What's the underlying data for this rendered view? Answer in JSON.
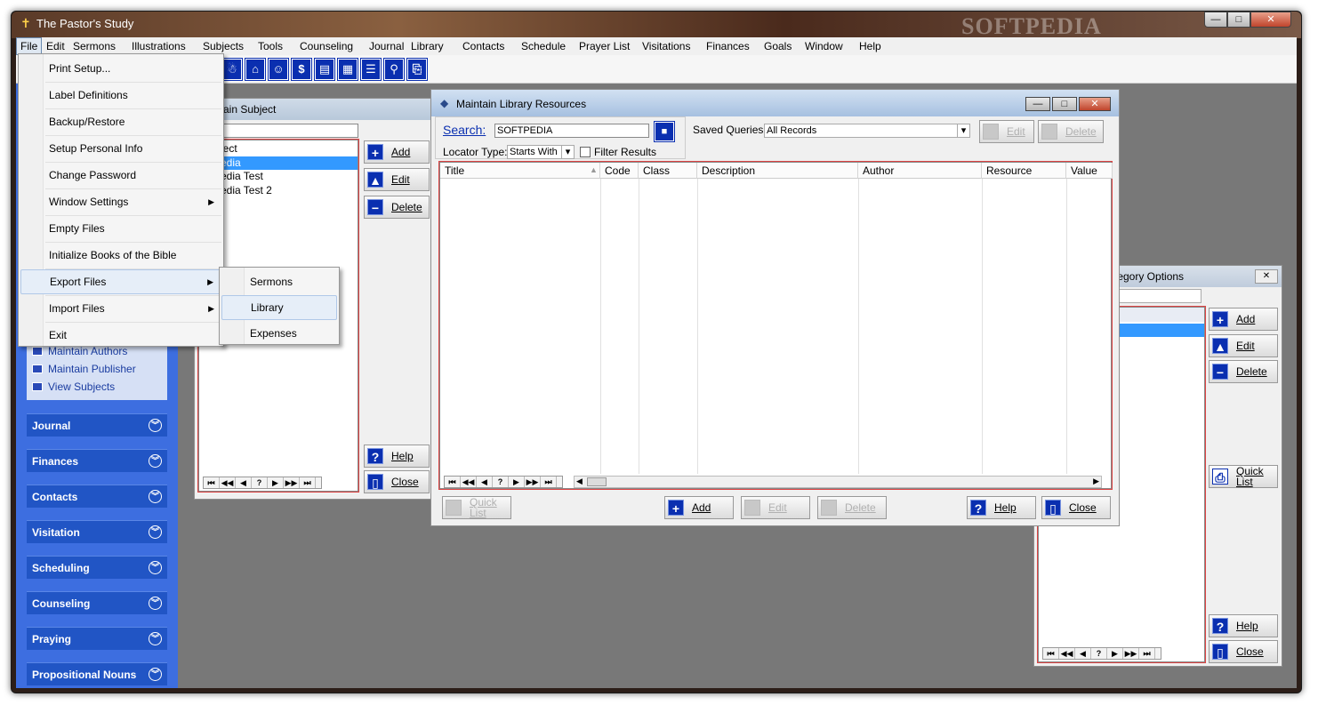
{
  "app": {
    "title": "The Pastor's Study",
    "watermark": "SOFTPEDIA",
    "caption_min": "—",
    "caption_max": "□",
    "caption_close": "✕"
  },
  "menubar": [
    "File",
    "Edit",
    "Sermons",
    "Illustrations",
    "Subjects",
    "Tools",
    "Counseling",
    "Journal",
    "Library",
    "Contacts",
    "Schedule",
    "Prayer List",
    "Visitations",
    "Finances",
    "Goals",
    "Window",
    "Help"
  ],
  "toolbar_icons": [
    "person-icon",
    "home-icon",
    "people-icon",
    "dollar-icon",
    "document-icon",
    "grid-icon",
    "list-icon",
    "search-people-icon",
    "exit-door-icon"
  ],
  "toolbar_glyphs": [
    "☃",
    "⌂",
    "☺",
    "$",
    "▤",
    "▦",
    "☰",
    "⚲",
    "⎘"
  ],
  "file_menu": [
    {
      "label": "Print Setup...",
      "submenu": false
    },
    {
      "label": "Label Definitions",
      "submenu": false
    },
    {
      "label": "Backup/Restore",
      "submenu": false
    },
    {
      "label": "Setup Personal Info",
      "submenu": false
    },
    {
      "label": "Change Password",
      "submenu": false
    },
    {
      "label": "Window Settings",
      "submenu": true
    },
    {
      "label": "Empty Files",
      "submenu": false
    },
    {
      "label": "Initialize Books of the Bible",
      "submenu": false
    },
    {
      "label": "Export Files",
      "submenu": true
    },
    {
      "label": "Import Files",
      "submenu": true
    },
    {
      "label": "Exit",
      "submenu": false
    }
  ],
  "export_submenu": [
    "Sermons",
    "Library",
    "Expenses"
  ],
  "sidebar": {
    "links": [
      "Maintain Authors",
      "Maintain Publisher",
      "View Subjects"
    ],
    "sections": [
      "Journal",
      "Finances",
      "Contacts",
      "Visitation",
      "Scheduling",
      "Counseling",
      "Praying",
      "Propositional Nouns"
    ],
    "chevron": "︾"
  },
  "subject_window": {
    "title": "Maintain Subject",
    "title_visible": "ntain Subject",
    "items": [
      "ject",
      "edia",
      "edia Test",
      "edia Test 2"
    ],
    "selected_index": 1,
    "buttons": {
      "add": "Add",
      "edit": "Edit",
      "delete": "Delete",
      "help": "Help",
      "close": "Close"
    }
  },
  "library_window": {
    "title": "Maintain Library Resources",
    "search_label": "Search:",
    "search_value": "SOFTPEDIA",
    "locator_label": "Locator Type:",
    "locator_value": "Starts With",
    "filter_label": "Filter Results",
    "saved_queries_label": "Saved Queries:",
    "saved_queries_value": "All Records",
    "top_edit": "Edit",
    "top_delete": "Delete",
    "columns": [
      "Title",
      "Code",
      "Class",
      "Description",
      "Author",
      "Resource",
      "Value"
    ],
    "buttons": {
      "quick_list": "Quick List",
      "add": "Add",
      "edit": "Edit",
      "delete": "Delete",
      "help": "Help",
      "close": "Close"
    }
  },
  "category_window": {
    "title": "Category Options",
    "title_visible": "tegory Options",
    "close_glyph": "✕",
    "buttons": {
      "add": "Add",
      "edit": "Edit",
      "delete": "Delete",
      "quick_list": "Quick List",
      "help": "Help",
      "close": "Close"
    }
  },
  "nav_glyphs": [
    "⏮",
    "◀◀",
    "◀",
    "?",
    "▶",
    "▶▶",
    "⏭"
  ],
  "icons": {
    "add": "+",
    "edit": "▲",
    "delete": "−",
    "help": "?",
    "close": "▯",
    "search": "■",
    "dropdown": "▾",
    "submenu": "▶"
  }
}
